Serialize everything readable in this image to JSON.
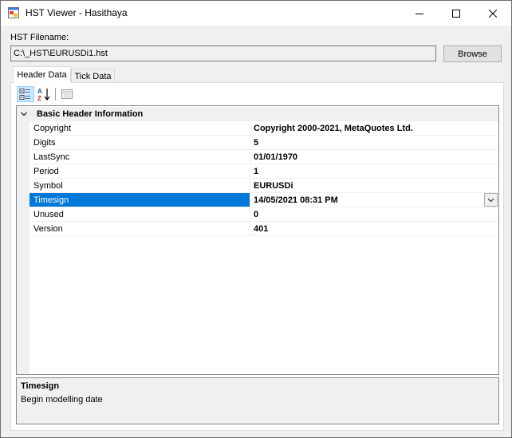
{
  "window": {
    "title": "HST Viewer - Hasithaya",
    "controls": [
      "minimize-icon",
      "maximize-icon",
      "close-icon"
    ]
  },
  "file": {
    "label": "HST Filename:",
    "path": "C:\\_HST\\EURUSDi1.hst",
    "browse_label": "Browse"
  },
  "tabs": [
    {
      "label": "Header Data",
      "active": true
    },
    {
      "label": "Tick Data",
      "active": false
    }
  ],
  "toolbar": {
    "buttons": [
      "categorized-icon",
      "alphabetical-icon",
      "property-pages-icon"
    ],
    "selected": "categorized-icon"
  },
  "grid": {
    "category": "Basic Header Information",
    "properties": [
      {
        "name": "Copyright",
        "value": "Copyright 2000-2021, MetaQuotes Ltd."
      },
      {
        "name": "Digits",
        "value": "5"
      },
      {
        "name": "LastSync",
        "value": "01/01/1970"
      },
      {
        "name": "Period",
        "value": "1"
      },
      {
        "name": "Symbol",
        "value": "EURUSDi"
      },
      {
        "name": "Timesign",
        "value": "14/05/2021 08:31 PM"
      },
      {
        "name": "Unused",
        "value": "0"
      },
      {
        "name": "Version",
        "value": "401"
      }
    ],
    "selected_property": "Timesign"
  },
  "help": {
    "title": "Timesign",
    "description": "Begin modelling date"
  },
  "colors": {
    "selection": "#0078d7",
    "toolbar_selected": "#cce8ff",
    "window_bg": "#f0f0f0"
  }
}
